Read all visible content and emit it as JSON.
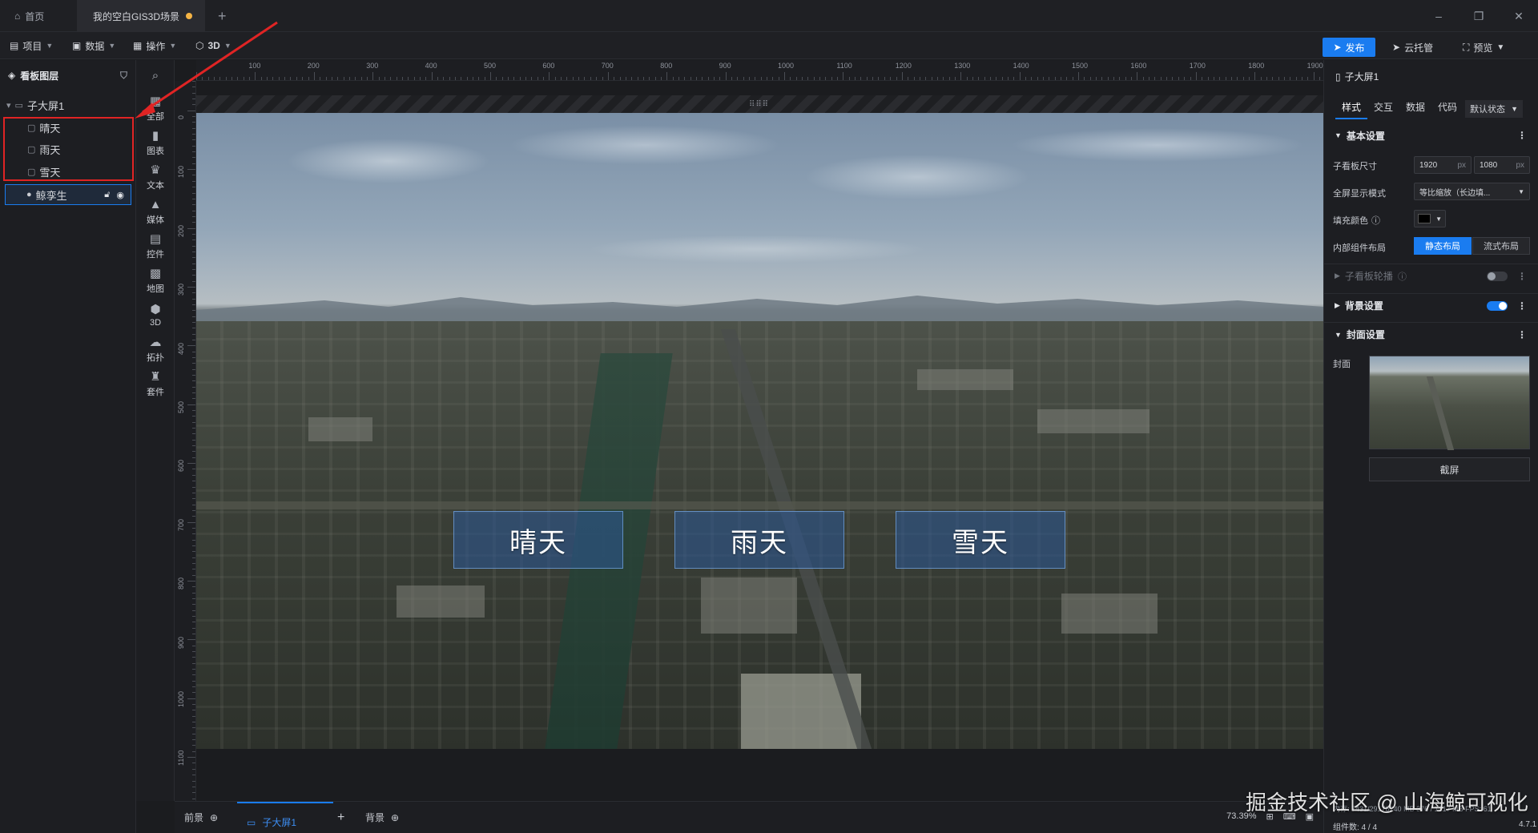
{
  "tabs": {
    "home": "首页",
    "scene": "我的空白GIS3D场景",
    "add": "+"
  },
  "menu": {
    "project": "项目",
    "data": "数据",
    "operate": "操作",
    "three_d": "3D",
    "publish": "发布",
    "cloud": "云托管",
    "preview": "预览"
  },
  "layers": {
    "title": "看板图层",
    "root": "子大屏1",
    "items": [
      "晴天",
      "雨天",
      "雪天"
    ],
    "twin": "鲸孪生"
  },
  "rail": [
    "全部",
    "图表",
    "文本",
    "媒体",
    "控件",
    "地图",
    "3D",
    "拓扑",
    "套件"
  ],
  "ruler": {
    "top": [
      "100",
      "200",
      "300",
      "400",
      "500",
      "600",
      "700",
      "800",
      "900",
      "1000",
      "1100",
      "1200",
      "1300",
      "1400",
      "1500",
      "1600",
      "1700",
      "1800",
      "1900"
    ],
    "left": [
      "0",
      "100",
      "200",
      "300",
      "400",
      "500",
      "600",
      "700",
      "800",
      "900",
      "1000",
      "1100"
    ]
  },
  "canvas": {
    "buttons": [
      "晴天",
      "雨天",
      "雪天"
    ]
  },
  "bottom": {
    "foreground": "前景",
    "screen": "子大屏1",
    "background": "背景",
    "zoom": "73.39%"
  },
  "panel": {
    "title": "子大屏1",
    "tabs": [
      "样式",
      "交互",
      "数据",
      "代码"
    ],
    "state": "默认状态",
    "basic": "基本设置",
    "size_label": "子看板尺寸",
    "width": "1920",
    "height": "1080",
    "unit": "px",
    "fullscreen_label": "全屏显示模式",
    "fullscreen_value": "等比缩放（长边填...",
    "fill_label": "填充颜色",
    "layout_label": "内部组件布局",
    "layout_static": "静态布局",
    "layout_flow": "流式布局",
    "carousel": "子看板轮播",
    "bg_settings": "背景设置",
    "cover_settings": "封面设置",
    "cover_label": "封面",
    "capture": "截屏"
  },
  "status": {
    "mem": "内存: 7431/29178240 MB 376 / 1317 MB FPS: 61",
    "count": "组件数: 4 / 4",
    "version": "4.7.1",
    "watermark": "掘金技术社区 @ 山海鲸可视化"
  },
  "colors": {
    "accent": "#1a7cf0",
    "highlight": "#e02424",
    "unsaved_dot": "#f5b445"
  }
}
